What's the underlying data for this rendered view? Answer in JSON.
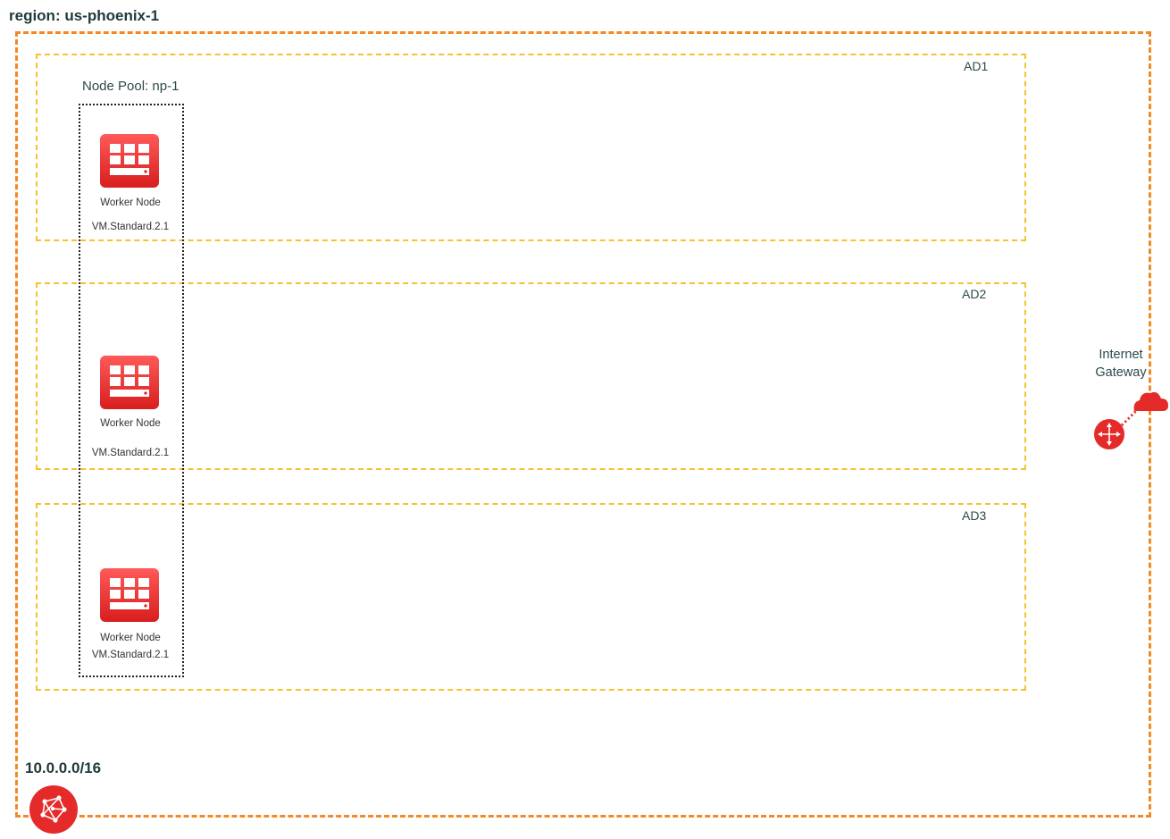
{
  "region": {
    "title": "region: us-phoenix-1",
    "border_color": "#f08a24"
  },
  "availability_domains": [
    {
      "label": "AD1"
    },
    {
      "label": "AD2"
    },
    {
      "label": "AD3"
    }
  ],
  "ad_border_color": "#f5c230",
  "node_pool": {
    "label": "Node Pool: np-1"
  },
  "worker_nodes": [
    {
      "name": "Worker Node",
      "shape": "VM.Standard.2.1",
      "icon": "compute-vm-icon"
    },
    {
      "name": "Worker Node",
      "shape": "VM.Standard.2.1",
      "icon": "compute-vm-icon"
    },
    {
      "name": "Worker Node",
      "shape": "VM.Standard.2.1",
      "icon": "compute-vm-icon"
    }
  ],
  "internet_gateway": {
    "label": "Internet Gateway",
    "icon": "internet-gateway-icon"
  },
  "vcn": {
    "cidr": "10.0.0.0/16",
    "icon": "vcn-icon"
  },
  "accent_color": "#e52a2a"
}
